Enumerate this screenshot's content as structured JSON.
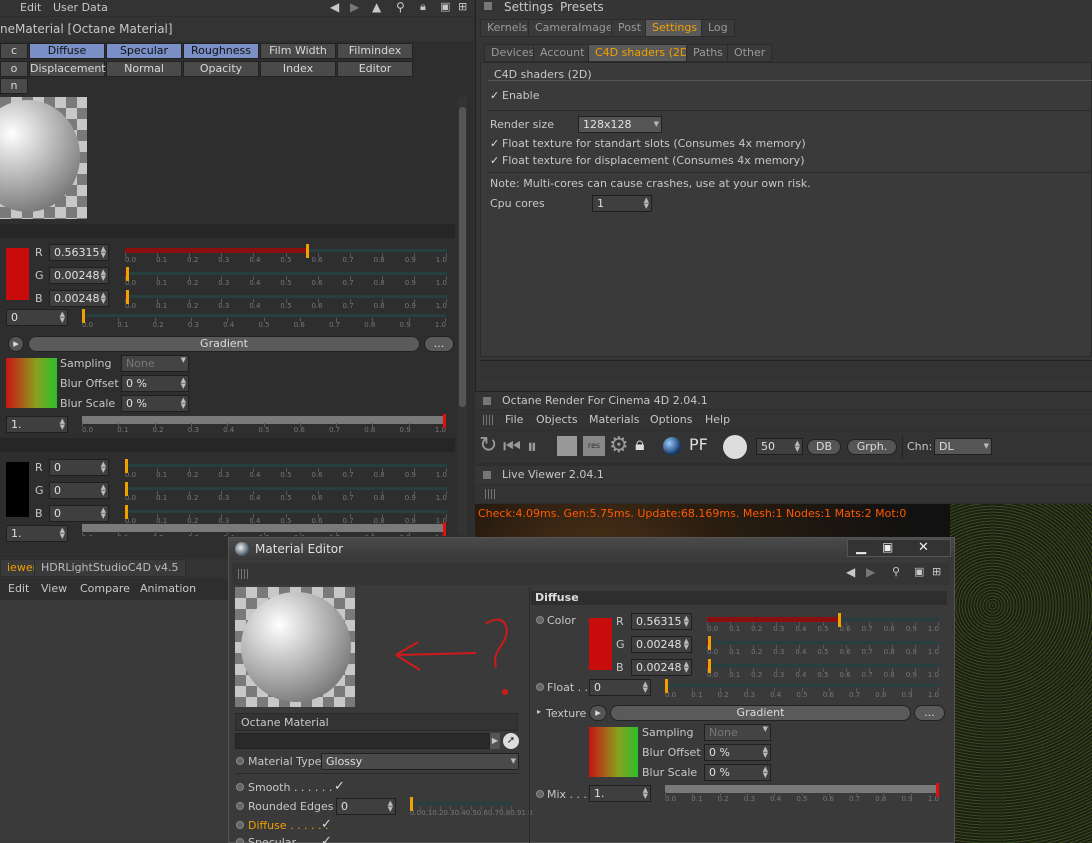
{
  "left": {
    "menu": [
      "Edit",
      "User Data"
    ],
    "title": "neMaterial [Octane Material]",
    "channel_tabs": [
      [
        "Diffuse",
        "Specular",
        "Roughness",
        "Film Width",
        "Filmindex"
      ],
      [
        "Displacement",
        "Normal",
        "Opacity",
        "Index",
        "Editor"
      ]
    ],
    "rgb": {
      "r": "0.56315",
      "g": "0.00248",
      "b": "0.00248",
      "r_labels": [
        "R",
        "G",
        "B"
      ],
      "color": "#c80b0b"
    },
    "float": "0",
    "gradient": "Gradient",
    "ellipsis": "...",
    "sampling_label": "Sampling",
    "sampling_value": "None",
    "blur_offset_label": "Blur Offset",
    "blur_offset": "0 %",
    "blur_scale_label": "Blur Scale",
    "blur_scale": "0 %",
    "mix": "1.",
    "rgb2": {
      "r": "0",
      "g": "0",
      "b": "0"
    },
    "mix2": "1.",
    "bottom_tabs": [
      "iewer",
      "HDRLightStudioC4D v4.5"
    ],
    "bottom_menu": [
      "Edit",
      "View",
      "Compare",
      "Animation"
    ]
  },
  "settings": {
    "menu": [
      "Settings",
      "Presets"
    ],
    "tabs": [
      "Kernels",
      "CameraImager",
      "Post",
      "Settings",
      "Log"
    ],
    "subtabs": [
      "Devices",
      "Account",
      "C4D shaders (2D)",
      "Paths",
      "Other"
    ],
    "group_title": "C4D shaders (2D)",
    "enable": "Enable",
    "render_size_label": "Render size",
    "render_size": "128x128",
    "float_std": "Float texture for standart slots (Consumes 4x memory)",
    "float_disp": "Float texture for displacement (Consumes 4x memory)",
    "note": "Note: Multi-cores can cause crashes, use at your own risk.",
    "cpu_label": "Cpu cores",
    "cpu_value": "1"
  },
  "octane": {
    "title": "Octane Render For Cinema 4D 2.04.1",
    "menu": [
      "File",
      "Objects",
      "Materials",
      "Options",
      "Help"
    ],
    "spp": "50",
    "db": "DB",
    "grph": "Grph.",
    "chn_label": "Chn:",
    "chn": "DL",
    "live_title": "Live Viewer 2.04.1",
    "status": "Check:4.09ms. Gen:5.75ms. Update:68.169ms. Mesh:1 Nodes:1 Mats:2 Mot:0"
  },
  "editor": {
    "title": "Material Editor",
    "material_name": "Octane Material",
    "material_type_label": "Material Type",
    "material_type": "Glossy",
    "smooth": "Smooth . . . . . .",
    "rounded_edges": "Rounded Edges",
    "rounded_value": "0",
    "diffuse_item": "Diffuse . . . . . .",
    "specular_item": "Specular",
    "section": "Diffuse",
    "color_label": "Color",
    "r": "0.56315",
    "g": "0.00248",
    "b": "0.00248",
    "float_label": "Float . .",
    "float_value": "0",
    "texture_label": "Texture",
    "gradient": "Gradient",
    "ellipsis": "...",
    "sampling_label": "Sampling",
    "sampling_value": "None",
    "blur_offset_label": "Blur Offset",
    "blur_offset": "0 %",
    "blur_scale_label": "Blur Scale",
    "blur_scale": "0 %",
    "mix_label": "Mix . . . .",
    "mix_value": "1."
  },
  "slider_ticks": [
    "0.0",
    "0.1",
    "0.2",
    "0.3",
    "0.4",
    "0.5",
    "0.6",
    "0.7",
    "0.8",
    "0.9",
    "1.0"
  ],
  "slider_values": {
    "r": 0.56315,
    "g": 0.00248,
    "b": 0.00248,
    "float": 0,
    "mix": 1.0,
    "rounded": 0
  }
}
